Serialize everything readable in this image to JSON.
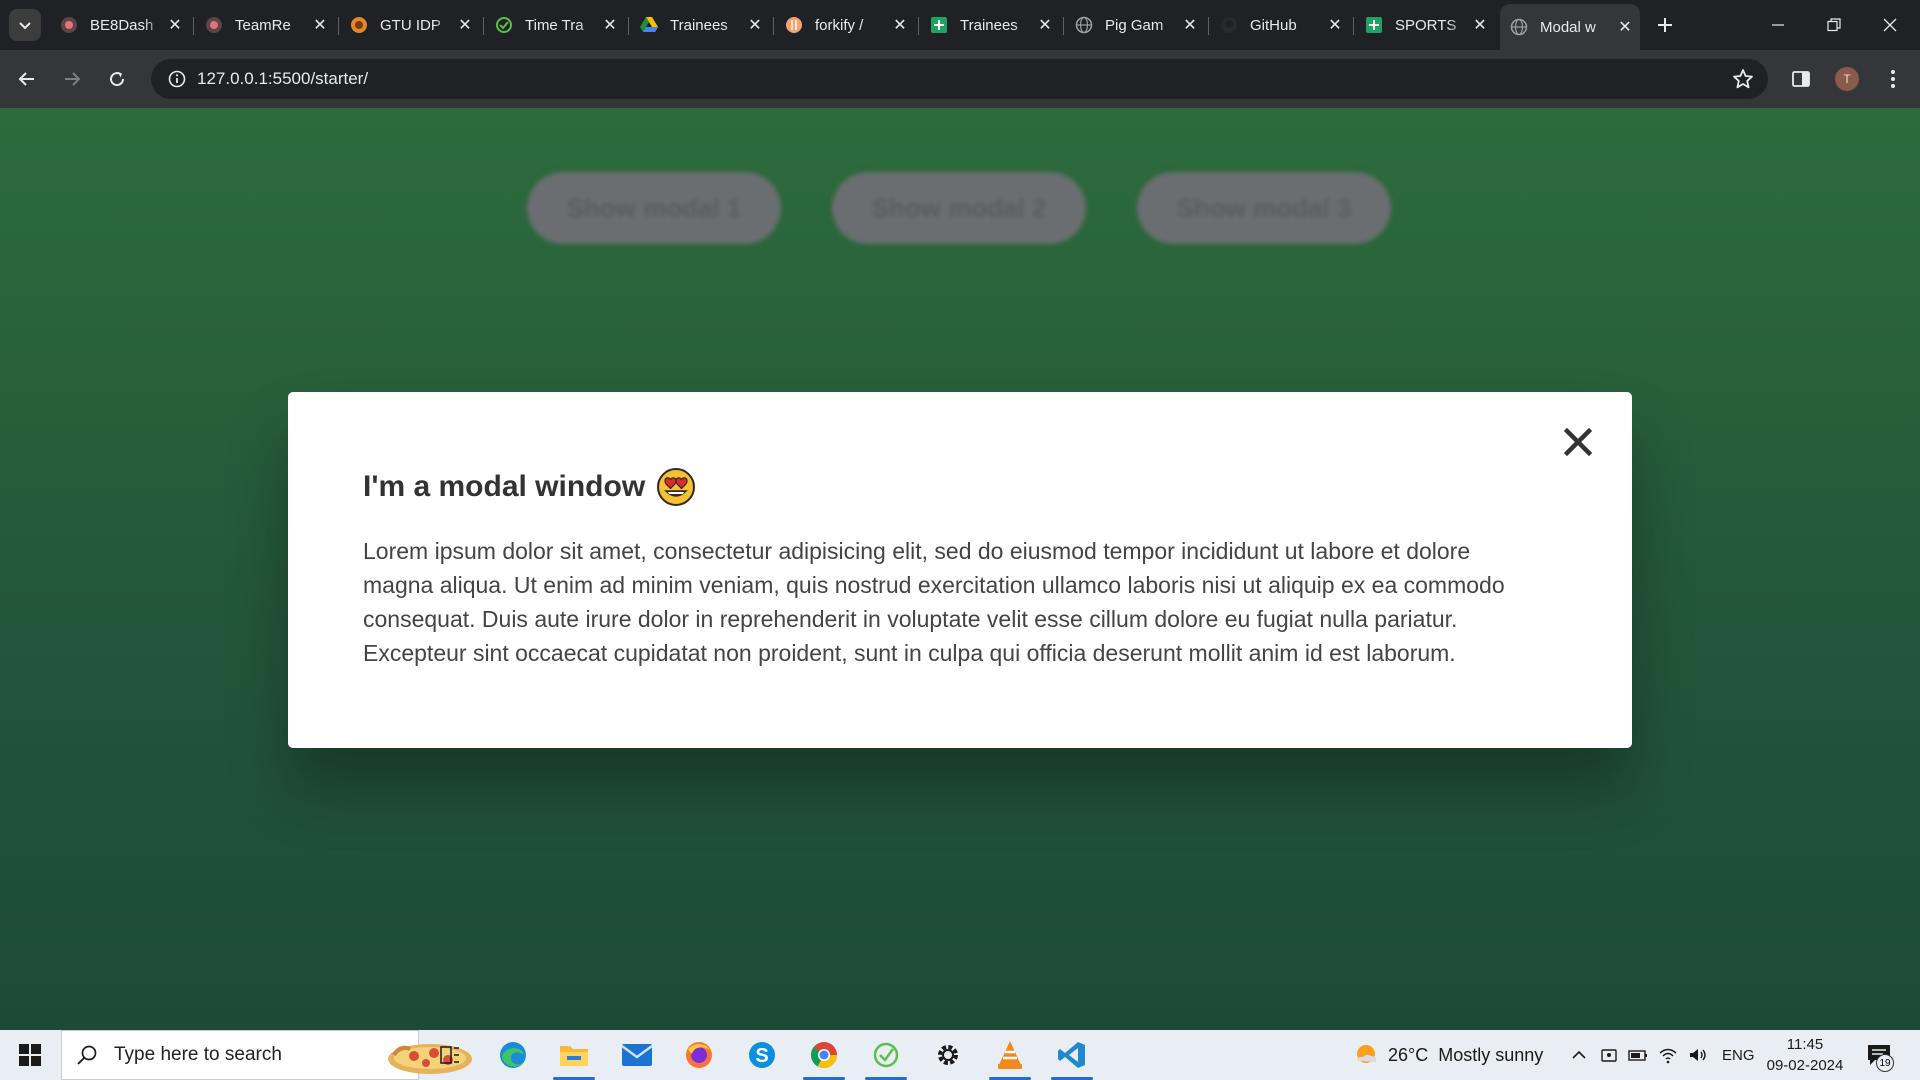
{
  "browser": {
    "tabs": [
      {
        "title": "BE8Dash",
        "icon": "record-icon",
        "active": false
      },
      {
        "title": "TeamRe",
        "icon": "record-icon",
        "active": false
      },
      {
        "title": "GTU IDP",
        "icon": "gtu-icon",
        "active": false
      },
      {
        "title": "Time Tra",
        "icon": "timer-icon",
        "active": false
      },
      {
        "title": "Trainees",
        "icon": "drive-icon",
        "active": false
      },
      {
        "title": "forkify /",
        "icon": "forkify-icon",
        "active": false
      },
      {
        "title": "Trainees",
        "icon": "sheets-icon",
        "active": false
      },
      {
        "title": "Pig Gam",
        "icon": "globe-icon",
        "active": false
      },
      {
        "title": "GitHub",
        "icon": "github-icon",
        "active": false
      },
      {
        "title": "SPORTS",
        "icon": "sheets-icon",
        "active": false
      },
      {
        "title": "Modal w",
        "icon": "globe-icon",
        "active": true
      }
    ],
    "url": "127.0.0.1:5500/starter/",
    "profile_initial": "T"
  },
  "page": {
    "buttons": [
      "Show modal 1",
      "Show modal 2",
      "Show modal 3"
    ],
    "modal": {
      "title": "I'm a modal window",
      "close_symbol": "×",
      "body": "Lorem ipsum dolor sit amet, consectetur adipisicing elit, sed do eiusmod tempor incididunt ut labore et dolore magna aliqua. Ut enim ad minim veniam, quis nostrud exercitation ullamco laboris nisi ut aliquip ex ea commodo consequat. Duis aute irure dolor in reprehenderit in voluptate velit esse cillum dolore eu fugiat nulla pariatur. Excepteur sint occaecat cupidatat non proident, sunt in culpa qui officia deserunt mollit anim id est laborum."
    }
  },
  "taskbar": {
    "search_placeholder": "Type here to search",
    "weather": {
      "temp": "26°C",
      "condition": "Mostly sunny"
    },
    "language": "ENG",
    "time": "11:45",
    "date": "09-02-2024",
    "notifications": "19"
  },
  "colors": {
    "page_bg_top": "#2d6b3c",
    "page_bg_bottom": "#1d4a37",
    "modal_bg": "#ffffff",
    "chrome_dark": "#202124",
    "taskbar_bg": "#e8eef3"
  }
}
